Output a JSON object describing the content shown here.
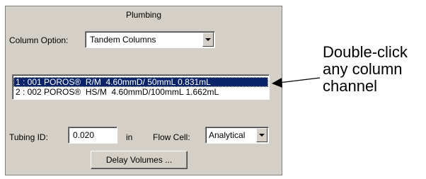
{
  "panel": {
    "title": "Plumbing",
    "column_option": {
      "label": "Column Option:",
      "value": "Tandem Columns"
    },
    "column_list": {
      "items": [
        {
          "text": "1 : 001 POROS®  R/M  4.60mmD/ 50mmL 0.831mL",
          "selected": true
        },
        {
          "text": "2 : 002 POROS®  HS/M  4.60mmD/100mmL 1.662mL",
          "selected": false
        }
      ]
    },
    "tubing_id": {
      "label": "Tubing ID:",
      "value": "0.020",
      "unit": "in"
    },
    "flow_cell": {
      "label": "Flow Cell:",
      "value": "Analytical"
    },
    "delay_volumes_button": "Delay Volumes ..."
  },
  "callout": {
    "lines": [
      "Double-click",
      "any column",
      "channel"
    ]
  }
}
